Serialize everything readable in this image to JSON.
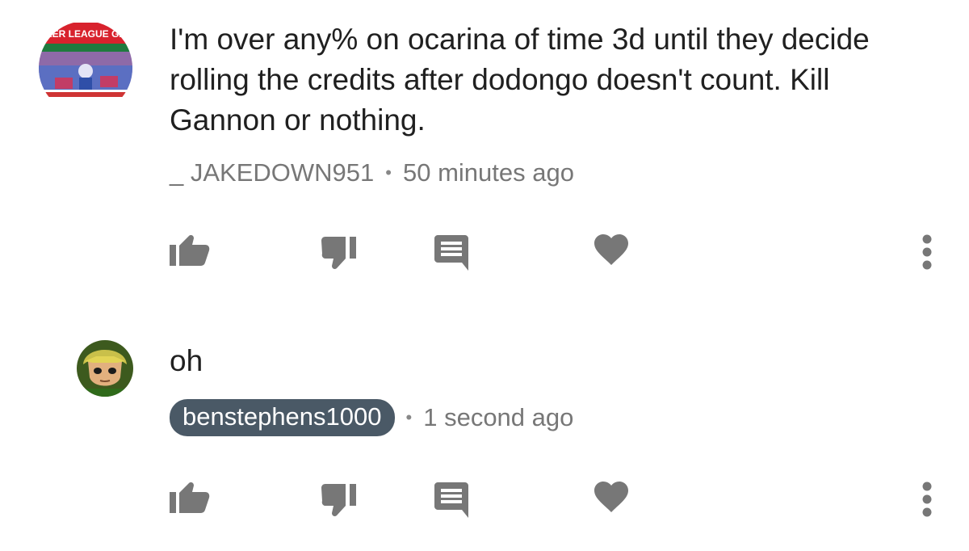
{
  "comments": [
    {
      "text": "I'm over any% on ocarina of time 3d until they decide rolling the credits after dodongo doesn't count. Kill Gannon or nothing.",
      "author": "_ JAKEDOWN951",
      "separator": "•",
      "time": "50 minutes ago",
      "avatar_banner_text": "KER LEAGUE GA"
    },
    {
      "text": "oh",
      "author": "benstephens1000",
      "separator": "•",
      "time": "1 second ago"
    }
  ],
  "colors": {
    "icon_gray": "#777777",
    "owner_chip_bg": "#4a5966",
    "text": "#202020",
    "meta": "#777777"
  },
  "icons": [
    "thumb-up-icon",
    "thumb-down-icon",
    "reply-icon",
    "heart-icon",
    "more-vert-icon"
  ]
}
